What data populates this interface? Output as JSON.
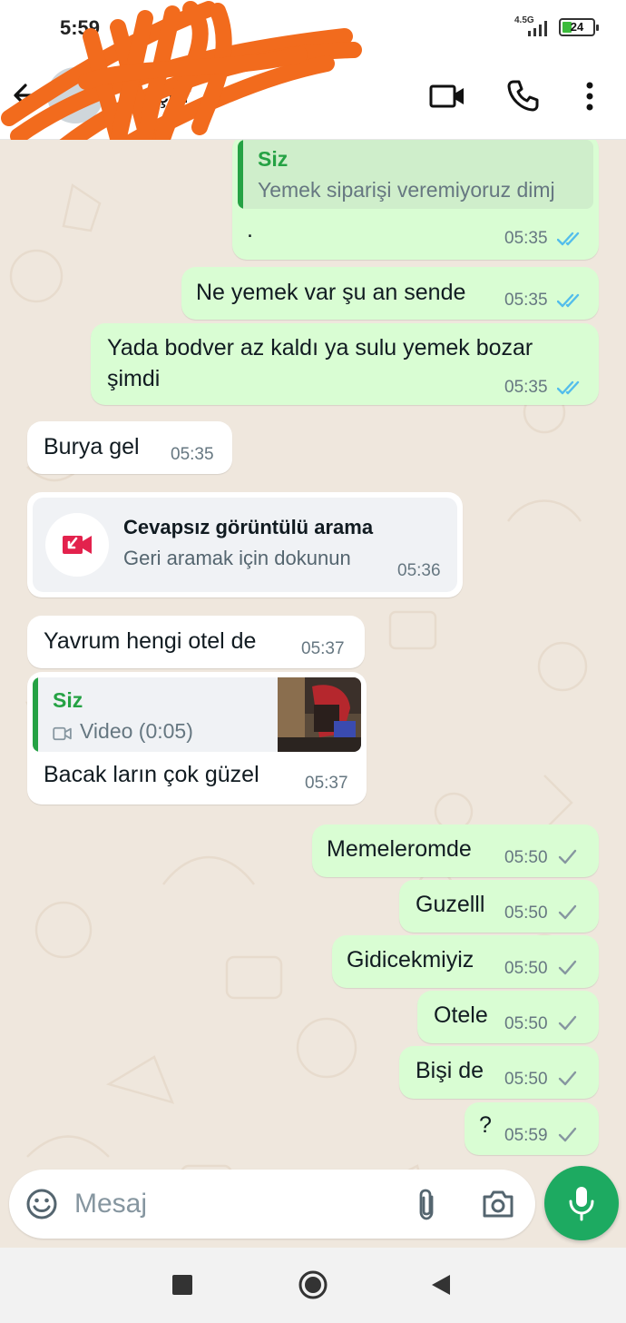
{
  "status_bar": {
    "time": "5:59",
    "network": "4.5G",
    "battery": "24"
  },
  "header": {
    "contact_name": "Dinçer"
  },
  "messages": [
    {
      "direction": "out",
      "quote_author": "Siz",
      "quote_text": "Yemek siparişi veremiyoruz dimj",
      "text": ".",
      "time": "05:35",
      "status": "read"
    },
    {
      "direction": "out",
      "text": "Ne yemek var şu an sende",
      "time": "05:35",
      "status": "read"
    },
    {
      "direction": "out",
      "text_line1": "Yada bodver az kaldı ya sulu yemek bozar",
      "text_line2": "şimdi",
      "time": "05:35",
      "status": "read"
    },
    {
      "direction": "in",
      "text": "Burya gel",
      "time": "05:35"
    },
    {
      "direction": "in",
      "missed_call_title": "Cevapsız görüntülü arama",
      "missed_call_sub": "Geri aramak için dokunun",
      "time": "05:36"
    },
    {
      "direction": "in",
      "text": "Yavrum hengi otel de",
      "time": "05:37"
    },
    {
      "direction": "in",
      "quote_author": "Siz",
      "quote_text": "Video (0:05)",
      "text": "Bacak ların çok güzel",
      "time": "05:37"
    },
    {
      "direction": "out",
      "text": "Memeleromde",
      "time": "05:50",
      "status": "delivered"
    },
    {
      "direction": "out",
      "text": "Guzelll",
      "time": "05:50",
      "status": "delivered"
    },
    {
      "direction": "out",
      "text": "Gidicekmiyiz",
      "time": "05:50",
      "status": "delivered"
    },
    {
      "direction": "out",
      "text": "Otele",
      "time": "05:50",
      "status": "delivered"
    },
    {
      "direction": "out",
      "text": "Bişi de",
      "time": "05:50",
      "status": "delivered"
    },
    {
      "direction": "out",
      "text": "?",
      "time": "05:59",
      "status": "delivered"
    }
  ],
  "input": {
    "placeholder": "Mesaj"
  },
  "icons": {
    "back": "arrow-left-icon",
    "video_call": "video-camera-icon",
    "voice_call": "phone-icon",
    "menu": "more-vertical-icon",
    "emoji": "smiley-icon",
    "attach": "paperclip-icon",
    "camera": "camera-icon",
    "mic": "microphone-icon"
  },
  "colors": {
    "outgoing_bubble": "#d9fdd3",
    "incoming_bubble": "#ffffff",
    "accent_green": "#25a244",
    "read_ticks": "#53bdeb",
    "missed_call_red": "#e3224d",
    "mic_button": "#1daa61"
  }
}
